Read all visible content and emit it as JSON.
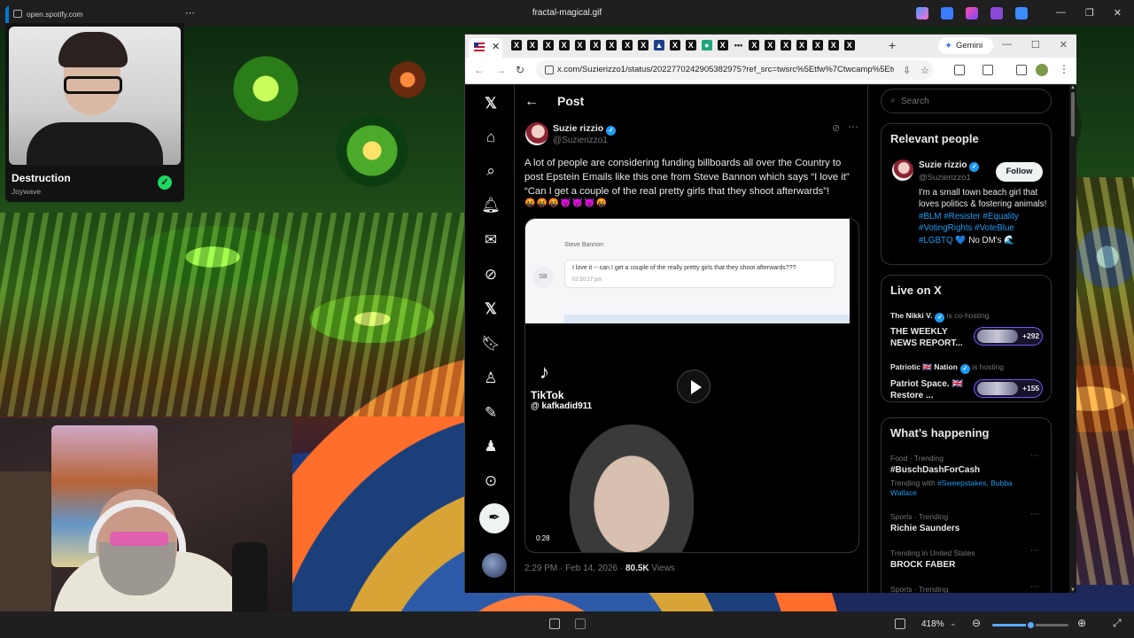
{
  "viewer": {
    "title": "fractal-magical.gif",
    "zoom": "418%",
    "zoom_level_fraction": 0.5
  },
  "spotify": {
    "url": "open.spotify.com",
    "track": "Destruction",
    "artist": "Joywave"
  },
  "browser": {
    "gemini_label": "Gemini",
    "url": "x.com/Suzierizzo1/status/2022770242905382975?ref_src=twsrc%5Etfw%7Ctwcamp%5Etwe..."
  },
  "post": {
    "heading": "Post",
    "author_name": "Suzie rizzio",
    "author_handle": "@Suzierizzo1",
    "text": "A lot of people are considering funding billboards all over the Country to post Epstein Emails like this one from Steve Bannon which says “I love it” “Can I get a couple of the real pretty girls that they shoot afterwards”!",
    "emojis": "🤬🤬🤬😈😈😈🤬",
    "email_from": "Steve Bannon",
    "email_initials": "SB",
    "email_message": "I love it -- can I get a couple of the really pretty girls that they shoot afterwards???",
    "email_time": "03:50:27 pm",
    "tiktok_label": "TikTok",
    "tiktok_user": "@ kafkadid911",
    "video_duration": "0:28",
    "timestamp": "2:29 PM · Feb 14, 2026 · ",
    "views_count": "80.5K",
    "views_label": " Views"
  },
  "sidebar": {
    "search_placeholder": "Search",
    "relevant_title": "Relevant people",
    "rp_name": "Suzie rizzio",
    "rp_handle": "@Suzierizzo1",
    "follow_label": "Follow",
    "rp_bio_text": "I'm a small town beach girl that loves politics & fostering animals! ",
    "rp_bio_tags": "#BLM #Resister #Equality #VotingRights #VoteBlue #LGBTQ",
    "rp_bio_end": " 💙 No DM's 🌊",
    "live_title": "Live on X",
    "live": [
      {
        "host": "The Nikki V.",
        "status": " is co-hosting",
        "title": "THE WEEKLY NEWS REPORT...",
        "count": "+292"
      },
      {
        "host": "Patriotic 🇬🇧 Nation",
        "status": " is hosting",
        "title": "Patriot Space. 🇬🇧 Restore ...",
        "count": "+155"
      }
    ],
    "happening_title": "What’s happening",
    "trends": [
      {
        "category": "Food · Trending",
        "name": "#BuschDashForCash",
        "with_prefix": "Trending with ",
        "with_tags": "#Sweepstakes, Bubba Wallace"
      },
      {
        "category": "Sports · Trending",
        "name": "Richie Saunders"
      },
      {
        "category": "Trending in United States",
        "name": "BROCK FABER"
      },
      {
        "category": "Sports · Trending",
        "name": ""
      }
    ]
  }
}
